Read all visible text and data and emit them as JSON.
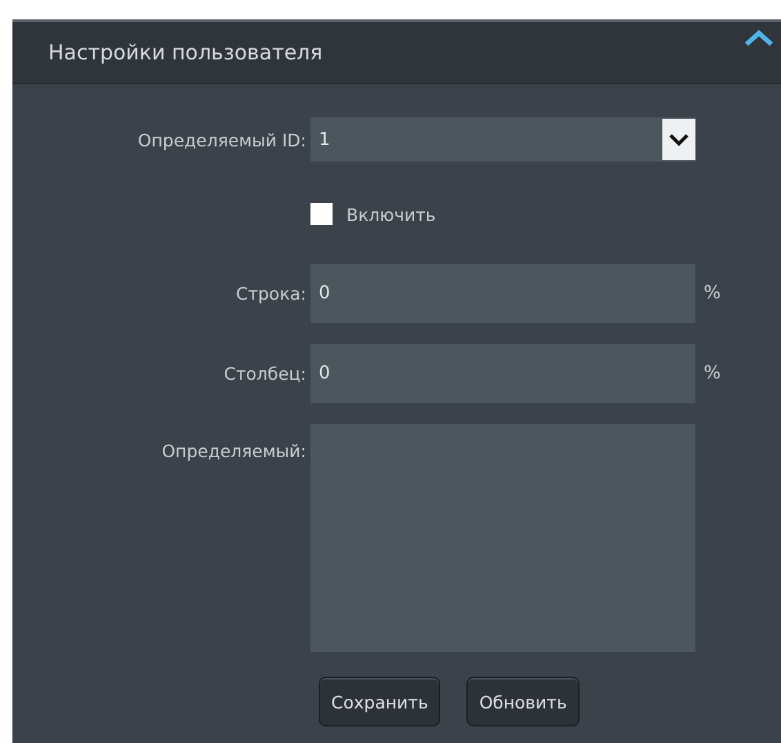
{
  "panel": {
    "title": "Настройки пользователя",
    "expanded": true
  },
  "id_select": {
    "label": "Определяемый ID:",
    "value": "1"
  },
  "enable": {
    "label": "Включить",
    "checked": false
  },
  "fields": [
    {
      "kind": "percent",
      "label": "Строка:",
      "value": "0",
      "unit": "%"
    },
    {
      "kind": "percent",
      "label": "Столбец:",
      "value": "0",
      "unit": "%"
    },
    {
      "kind": "textarea",
      "label": "Определяемый:"
    }
  ],
  "buttons": [
    "Сохранить",
    "Обновить"
  ]
}
